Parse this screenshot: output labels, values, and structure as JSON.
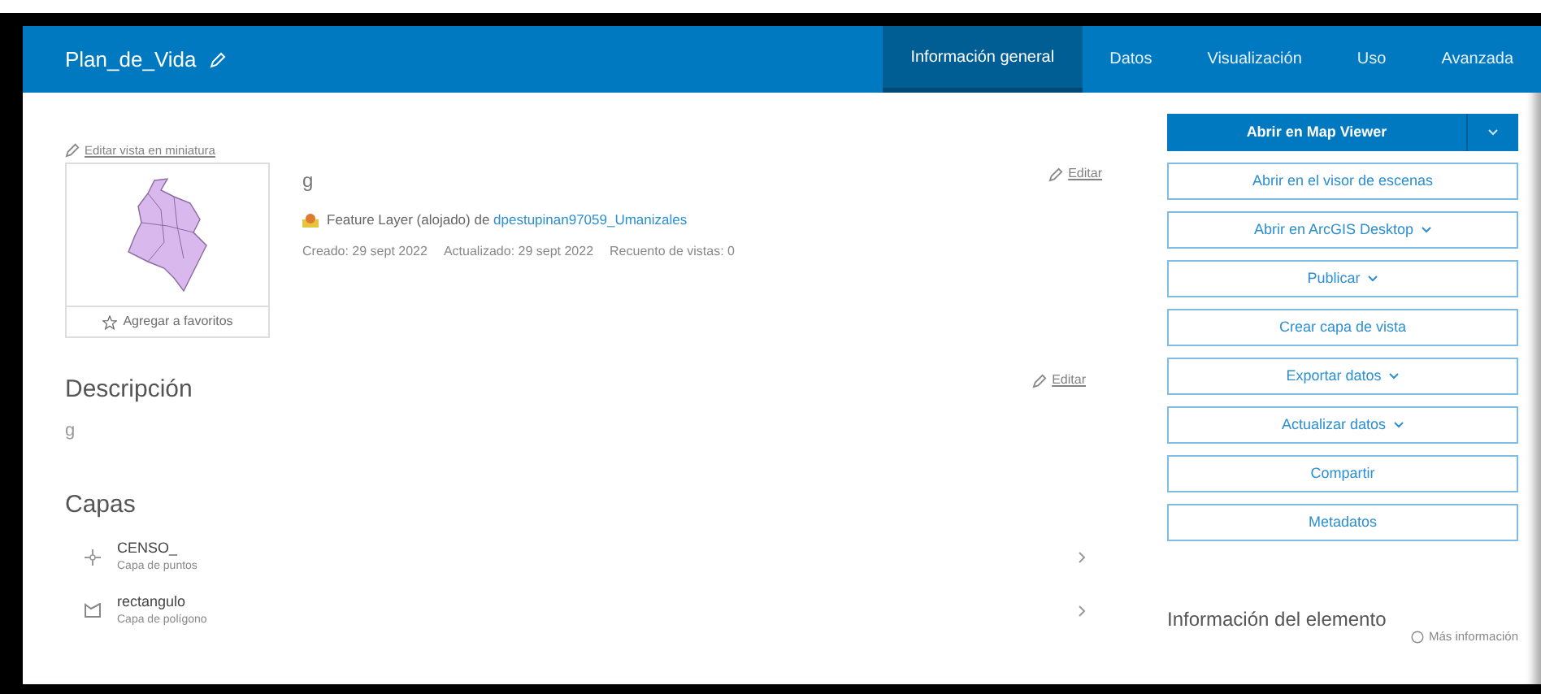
{
  "header": {
    "title": "Plan_de_Vida",
    "tabs": [
      {
        "label": "Información general",
        "selected": true
      },
      {
        "label": "Datos",
        "selected": false
      },
      {
        "label": "Visualización",
        "selected": false
      },
      {
        "label": "Uso",
        "selected": false
      },
      {
        "label": "Avanzada",
        "selected": false
      }
    ]
  },
  "thumbnail": {
    "edit_label": "Editar vista en miniatura",
    "favorite_label": "Agregar a favoritos"
  },
  "item": {
    "title": "g",
    "edit_label": "Editar",
    "type_text": "Feature Layer (alojado) de",
    "owner": "dpestupinan97059_Umanizales",
    "meta": [
      "Creado: 29 sept 2022",
      "Actualizado: 29 sept 2022",
      "Recuento de vistas: 0"
    ]
  },
  "description": {
    "heading": "Descripción",
    "edit_label": "Editar",
    "text": "g"
  },
  "layers": {
    "heading": "Capas",
    "items": [
      {
        "name": "CENSO_",
        "type": "Capa de puntos",
        "kind": "point"
      },
      {
        "name": "rectangulo",
        "type": "Capa de polígono",
        "kind": "polygon"
      }
    ]
  },
  "actions": [
    {
      "label": "Abrir en Map Viewer",
      "kind": "split"
    },
    {
      "label": "Abrir en el visor de escenas",
      "kind": "plain"
    },
    {
      "label": "Abrir en ArcGIS Desktop",
      "kind": "dropdown"
    },
    {
      "label": "Publicar",
      "kind": "dropdown"
    },
    {
      "label": "Crear capa de vista",
      "kind": "plain"
    },
    {
      "label": "Exportar datos",
      "kind": "dropdown"
    },
    {
      "label": "Actualizar datos",
      "kind": "dropdown"
    },
    {
      "label": "Compartir",
      "kind": "plain"
    },
    {
      "label": "Metadatos",
      "kind": "plain"
    }
  ],
  "item_info": {
    "heading": "Información del elemento",
    "help_link": "Más información"
  }
}
